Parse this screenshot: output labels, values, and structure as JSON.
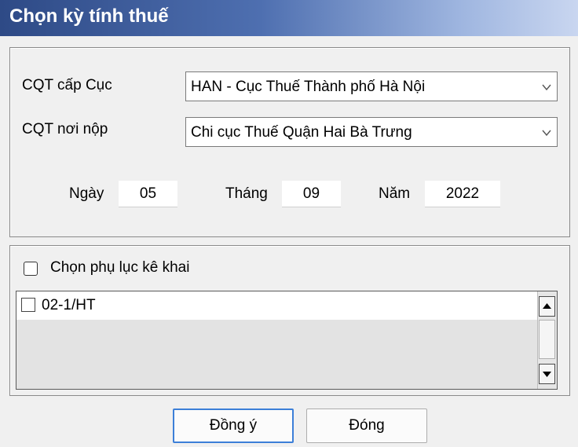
{
  "window": {
    "title": "Chọn kỳ tính thuế"
  },
  "form": {
    "cqt_cap_cuc_label": "CQT cấp Cục",
    "cqt_cap_cuc_value": "HAN - Cục Thuế Thành phố Hà Nội",
    "cqt_noi_nop_label": "CQT nơi nộp",
    "cqt_noi_nop_value": "Chi cục Thuế Quận Hai Bà Trưng",
    "day_label": "Ngày",
    "day_value": "05",
    "month_label": "Tháng",
    "month_value": "09",
    "year_label": "Năm",
    "year_value": "2022"
  },
  "appendix": {
    "select_label": "Chọn phụ lục kê khai",
    "items": [
      {
        "label": "02-1/HT",
        "checked": false
      }
    ]
  },
  "buttons": {
    "ok": "Đồng ý",
    "close": "Đóng"
  },
  "colors": {
    "titlebar_start": "#2e4a86",
    "titlebar_end": "#c9d6f0",
    "default_button_border": "#3c7fd8"
  }
}
